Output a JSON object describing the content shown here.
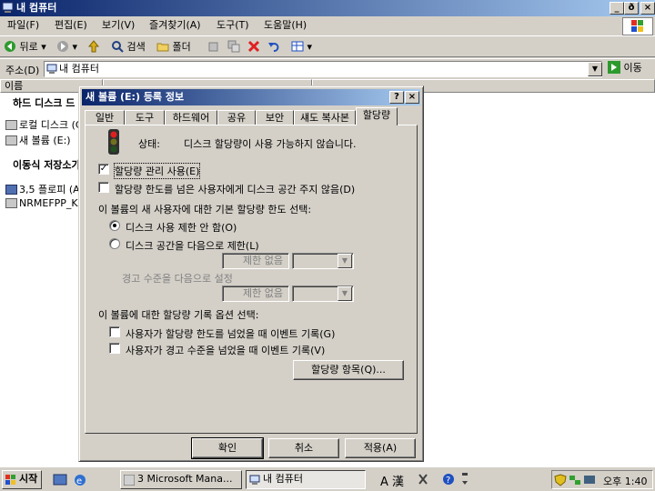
{
  "window": {
    "title": "내 컴퓨터",
    "controls": [
      "_",
      "ð",
      "×"
    ]
  },
  "menu": [
    "파일(F)",
    "편집(E)",
    "보기(V)",
    "즐겨찾기(A)",
    "도구(T)",
    "도움말(H)"
  ],
  "toolbar": {
    "back": "뒤로",
    "search": "검색",
    "folders": "폴더"
  },
  "address": {
    "label": "주소(D)",
    "value": "내 컴퓨터",
    "go": "이동"
  },
  "list": {
    "column_name": "이름",
    "group_hdd": "하드 디스크 드",
    "items_hdd": [
      "로컬 디스크 (C",
      "새 볼륨 (E:)"
    ],
    "group_removable": "이동식 저장소가",
    "items_removable": [
      "3,5 플로피 (A:",
      "NRMEFPP_K"
    ]
  },
  "dialog": {
    "title": "새 볼륨 (E:) 등록 정보",
    "tabs": [
      "일반",
      "도구",
      "하드웨어",
      "공유",
      "보안",
      "섀도 복사본",
      "할당량"
    ],
    "status_label": "상태:",
    "status_text": "디스크 할당량이 사용 가능하지 않습니다.",
    "enable_quota": "할당량 관리 사용(E)",
    "deny_space": "할당량 한도를 넘은 사용자에게 디스크 공간 주지 않음(D)",
    "default_limit_label": "이 볼륨의 새 사용자에 대한 기본 할당량 한도 선택:",
    "no_limit": "디스크 사용 제한 안 함(O)",
    "limit_to": "디스크 공간을 다음으로 제한(L)",
    "no_limit_field": "제한 없음",
    "warning_level": "경고 수준을 다음으로 설정",
    "no_limit_field2": "제한 없음",
    "logging_label": "이 볼륨에 대한 할당량 기록 옵션 선택:",
    "log_limit": "사용자가 할당량 한도를 넘었을 때 이벤트 기록(G)",
    "log_warning": "사용자가 경고 수준을 넘었을 때 이벤트 기록(V)",
    "entries_button": "할당량 항목(Q)...",
    "ok": "확인",
    "cancel": "취소",
    "apply": "적용(A)"
  },
  "taskbar": {
    "start": "시작",
    "task1": "3 Microsoft Mana...",
    "task2": "내 컴퓨터",
    "ime": "A 漢",
    "clock": "오후 1:40"
  },
  "colors": {
    "titlebar": "#0a246a",
    "face": "#d4d0c8"
  }
}
